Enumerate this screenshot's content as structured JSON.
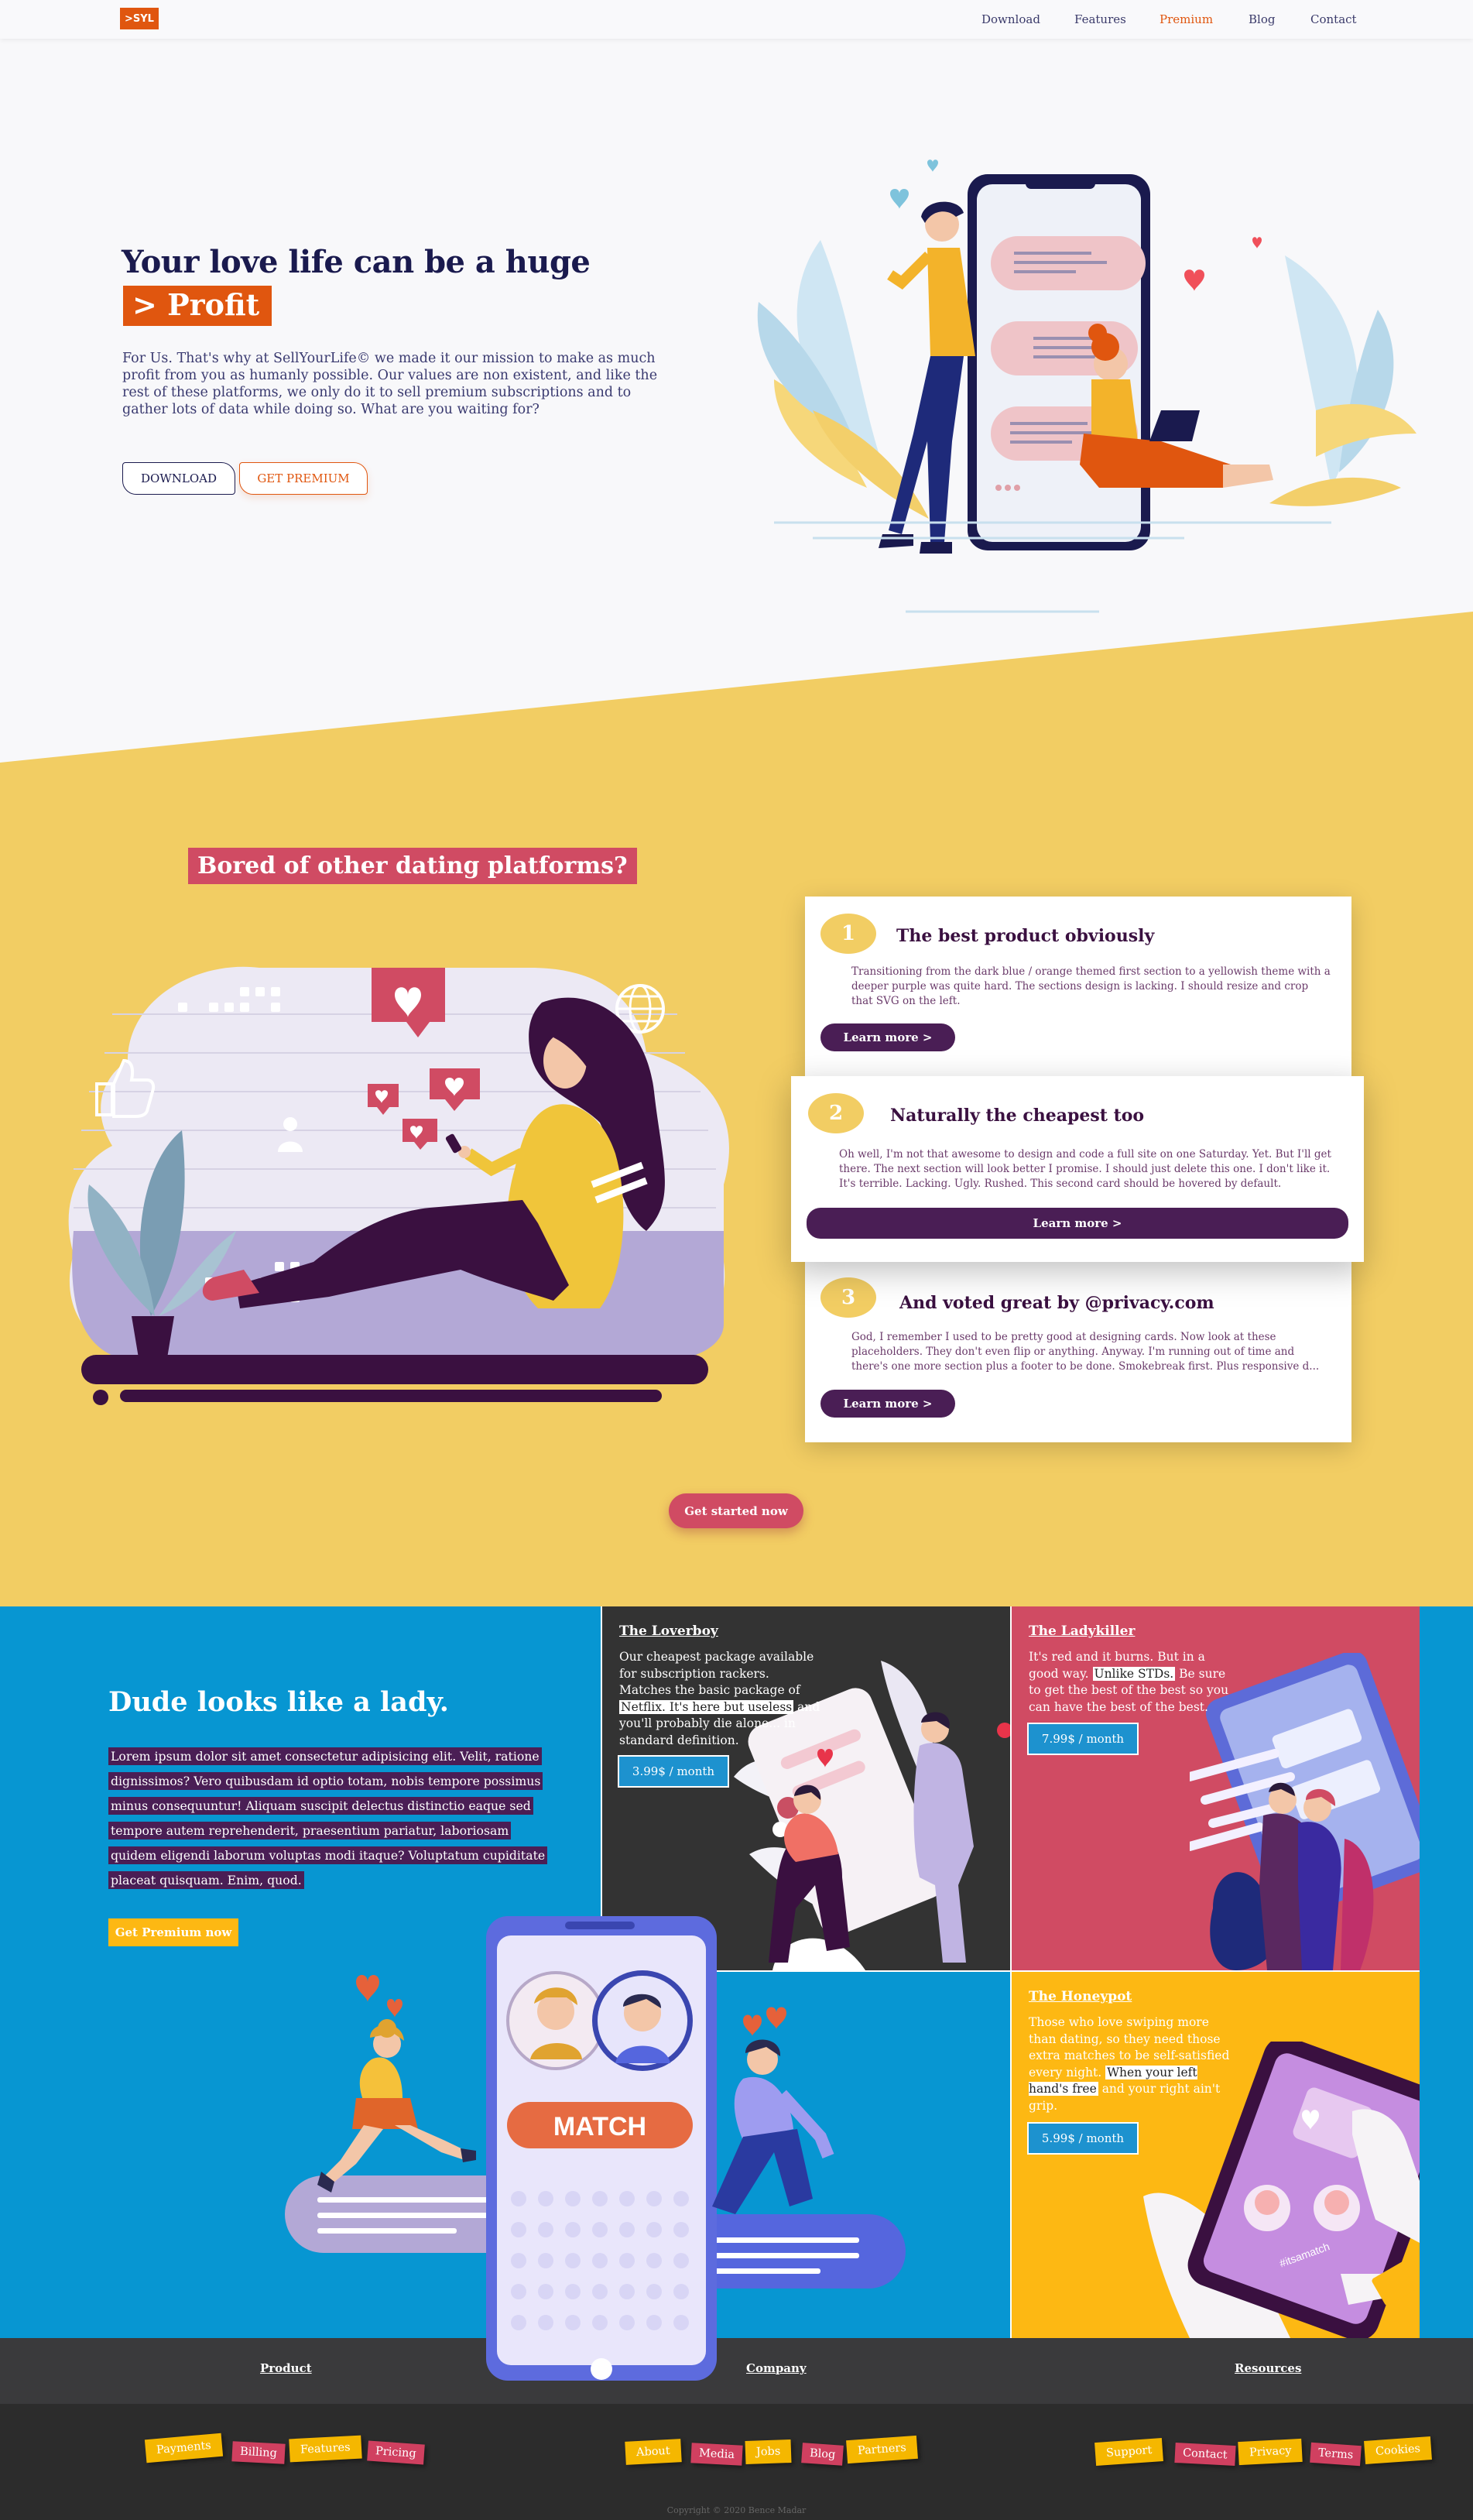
{
  "nav": {
    "logo": ">SYL",
    "links": [
      "Download",
      "Features",
      "Premium",
      "Blog",
      "Contact"
    ],
    "active": "Premium"
  },
  "hero": {
    "title": "Your love life can be a huge",
    "highlight": "> Profit",
    "text": "For Us. That's why at SellYourLife© we made it our mission to make as much profit from you as humanly possible. Our values are non existent, and like the rest of these platforms, we only do it to sell premium subscriptions and to gather lots of data while doing so. What are you waiting for?",
    "download_button": "DOWNLOAD",
    "premium_button": "GET PREMIUM"
  },
  "features": {
    "heading": "Bored of other dating platforms?",
    "cards": [
      {
        "number": "1",
        "title": "The best product obviously",
        "text": "Transitioning from the dark blue / orange themed first section to a yellowish theme with a deeper purple was quite hard. The sections design is lacking. I should resize and crop that SVG on the left.",
        "button": "Learn more >"
      },
      {
        "number": "2",
        "title": "Naturally the cheapest too",
        "text": "Oh well, I'm not that awesome to design and code a full site on one Saturday. Yet. But I'll get there. The next section will look better I promise. I should just delete this one. I don't like it. It's terrible. Lacking. Ugly. Rushed. This second card should be hovered by default.",
        "button": "Learn more >"
      },
      {
        "number": "3",
        "title": "And voted great by @privacy.com",
        "text": "God, I remember I used to be pretty good at designing cards. Now look at these placeholders. They don't even flip or anything. Anyway. I'm running out of time and there's one more section plus a footer to be done. Smokebreak first. Plus responsive d...",
        "button": "Learn more >"
      }
    ],
    "cta": "Get started now"
  },
  "pricing": {
    "heading": "Dude looks like a lady.",
    "lines": [
      "Lorem ipsum dolor sit amet consectetur adipisicing elit. Velit, ratione",
      "dignissimos? Vero quibusdam id optio totam, nobis tempore possimus",
      "minus consequuntur! Aliquam suscipit delectus distinctio eaque sed",
      "tempore autem reprehenderit, praesentium pariatur, laboriosam",
      "quidem eligendi laborum voluptas modi itaque? Voluptatum cupiditate",
      "placeat quisquam. Enim, quod."
    ],
    "button": "Get Premium now",
    "match_label": "MATCH",
    "phone_caption": "#itsamatch",
    "plans": [
      {
        "title": "The Loverboy",
        "text_parts": [
          "Our cheapest package available for subscription rackers. Matches the basic package of ",
          "Netflix. It's here but useless",
          " and you'll probably die alone... in standard definition."
        ],
        "price": "3.99$ / month"
      },
      {
        "title": "The Ladykiller",
        "text_parts": [
          "It's red and it burns. But in a good way. ",
          "Unlike STDs.",
          " Be sure to get the best of the best so you can have the best of the best."
        ],
        "price": "7.99$ / month"
      },
      {
        "title": "The Honeypot",
        "text_parts": [
          "Those who love swiping more than dating, so they need those extra matches to be self-satisfied every night. ",
          "When your left hand's free",
          " and your right ain't grip."
        ],
        "price": "5.99$ / month"
      }
    ]
  },
  "footer": {
    "columns": [
      {
        "heading": "Product",
        "tags": [
          "Payments",
          "Billing",
          "Features",
          "Pricing"
        ]
      },
      {
        "heading": "Company",
        "tags": [
          "About",
          "Media",
          "Jobs",
          "Blog",
          "Partners"
        ]
      },
      {
        "heading": "Resources",
        "tags": [
          "Support",
          "Contact",
          "Privacy",
          "Terms",
          "Cookies"
        ]
      }
    ],
    "copyright": "Copyright © 2020 Bence Madar"
  },
  "colors": {
    "orange": "#e0560f",
    "navy": "#1a1a4e",
    "yellow": "#f2cd63",
    "purple": "#4a1e55",
    "crimson": "#d04b63",
    "blue": "#0796d2",
    "dark": "#333333",
    "gold": "#fdb813"
  },
  "icons": [
    "heart-icon",
    "like-icon",
    "globe-icon",
    "user-icon"
  ]
}
